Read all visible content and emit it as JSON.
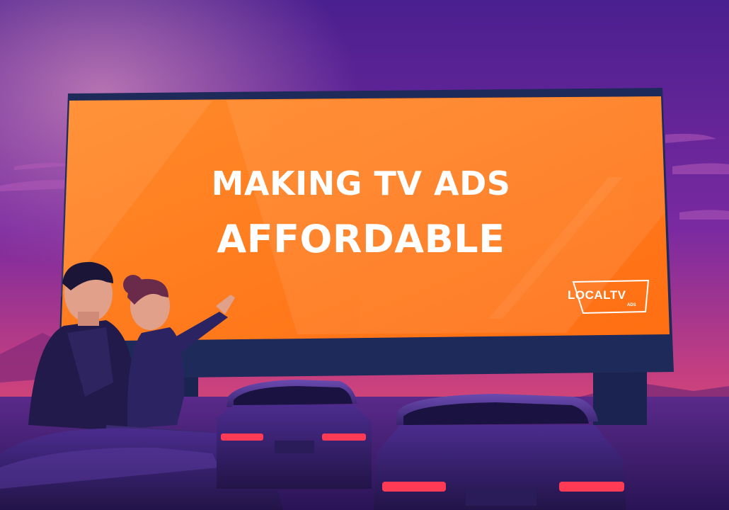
{
  "billboard": {
    "headline_line1": "MAKING TV ADS",
    "headline_line2": "AFFORDABLE"
  },
  "logo": {
    "main": "LOCALTV",
    "sub": "ADS"
  },
  "colors": {
    "sky_top": "#4a1f8f",
    "sky_bottom": "#e0447a",
    "screen": "#ff7a1a",
    "screen_frame": "#1e2a5a",
    "text": "#ffffff"
  }
}
